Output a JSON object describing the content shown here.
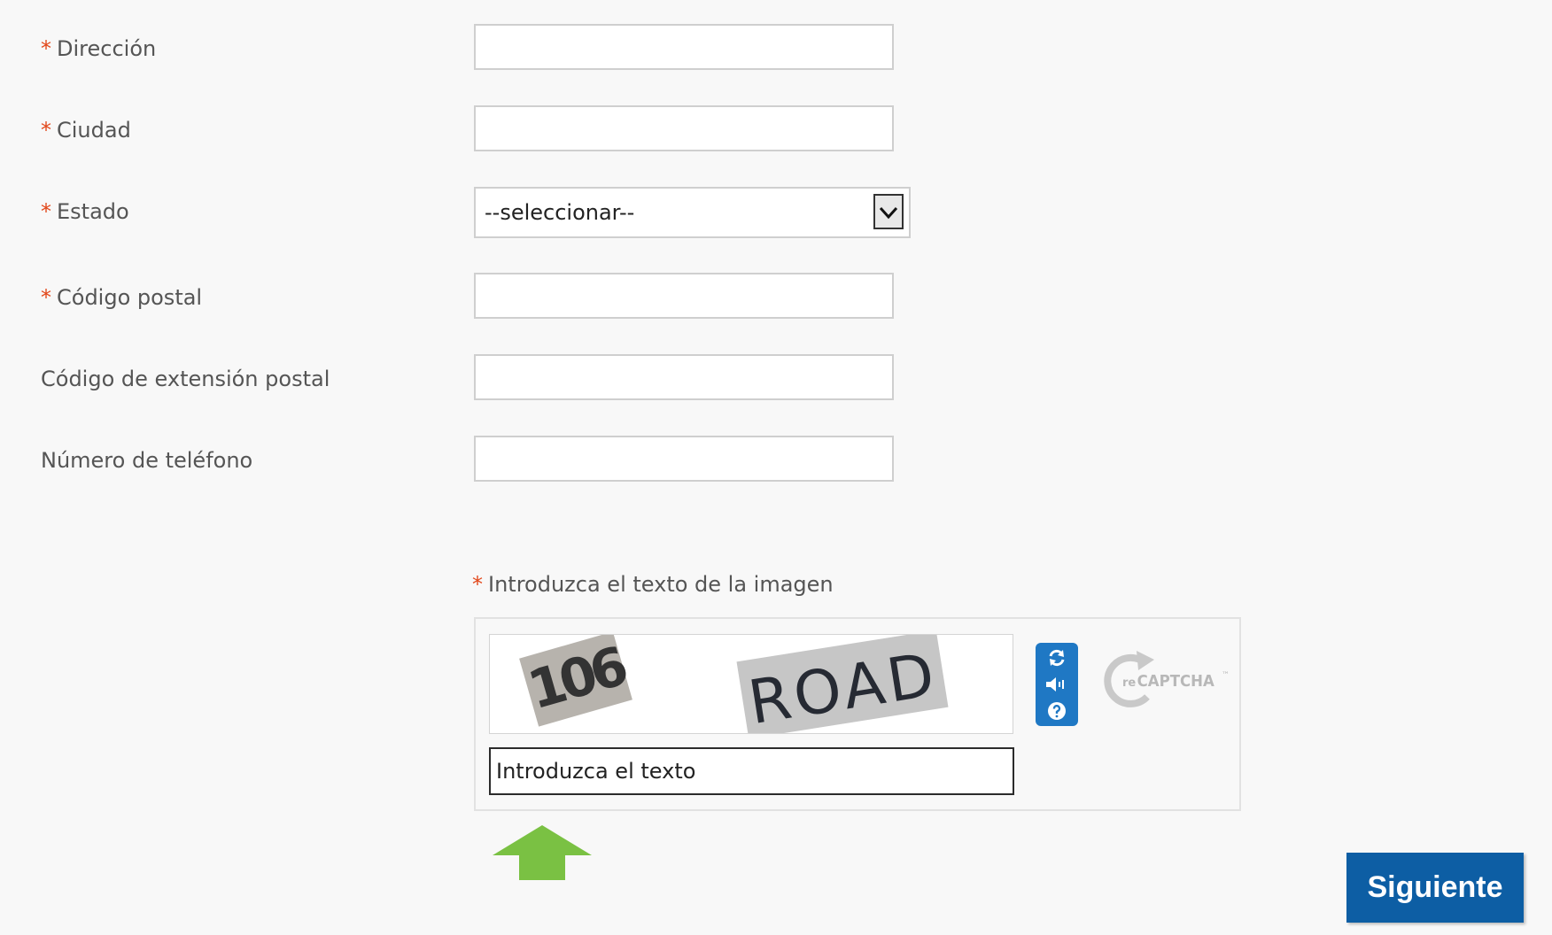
{
  "form": {
    "required_marker": "*",
    "fields": [
      {
        "label": "Dirección",
        "required": true,
        "value": ""
      },
      {
        "label": "Ciudad",
        "required": true,
        "value": ""
      },
      {
        "label": "Estado",
        "required": true,
        "value": "--seleccionar--"
      },
      {
        "label": "Código postal",
        "required": true,
        "value": ""
      },
      {
        "label": "Código de extensión postal",
        "required": false,
        "value": ""
      },
      {
        "label": "Número de teléfono",
        "required": false,
        "value": ""
      }
    ]
  },
  "captcha": {
    "label": "Introduzca el texto de la imagen",
    "image_words": [
      "106",
      "ROAD"
    ],
    "input_value": "Introduzca el texto",
    "brand": "reCAPTCHA",
    "brand_prefix": "re",
    "brand_suffix": "CAPTCHA",
    "trademark": "™",
    "icons": [
      "refresh-icon",
      "audio-icon",
      "help-icon"
    ]
  },
  "actions": {
    "next_label": "Siguiente"
  },
  "colors": {
    "required": "#e2471a",
    "label": "#555555",
    "button": "#0d5ea4",
    "captcha_controls": "#1f78c4",
    "hint_arrow": "#7ac143"
  }
}
